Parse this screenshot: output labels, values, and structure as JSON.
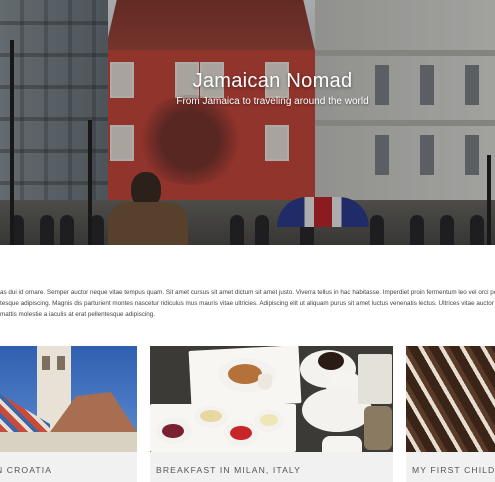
{
  "hero": {
    "title": "Jamaican Nomad",
    "subtitle": "From Jamaica to traveling around the world"
  },
  "intro": {
    "lines": [
      "as dui id ornare. Semper auctor neque vitae tempus quam. Sit amet cursus sit amet dictum sit amet justo. Viverra tellus in hac habitasse. Imperdiet proin fermentum leo vel orci porta",
      "tesque adipiscing. Magnis dis parturient montes nascetur ridiculus mus mauris vitae ultricies. Adipiscing elit ut aliquam purus sit amet luctus venenatis lectus. Ultrices vitae auctor eu a",
      "mattis molestie a iaculis at erat pellentesque adipiscing."
    ]
  },
  "cards": [
    {
      "label": "N CROATIA"
    },
    {
      "label": "BREAKFAST IN MILAN, ITALY"
    },
    {
      "label": "MY FIRST CHILD"
    }
  ]
}
